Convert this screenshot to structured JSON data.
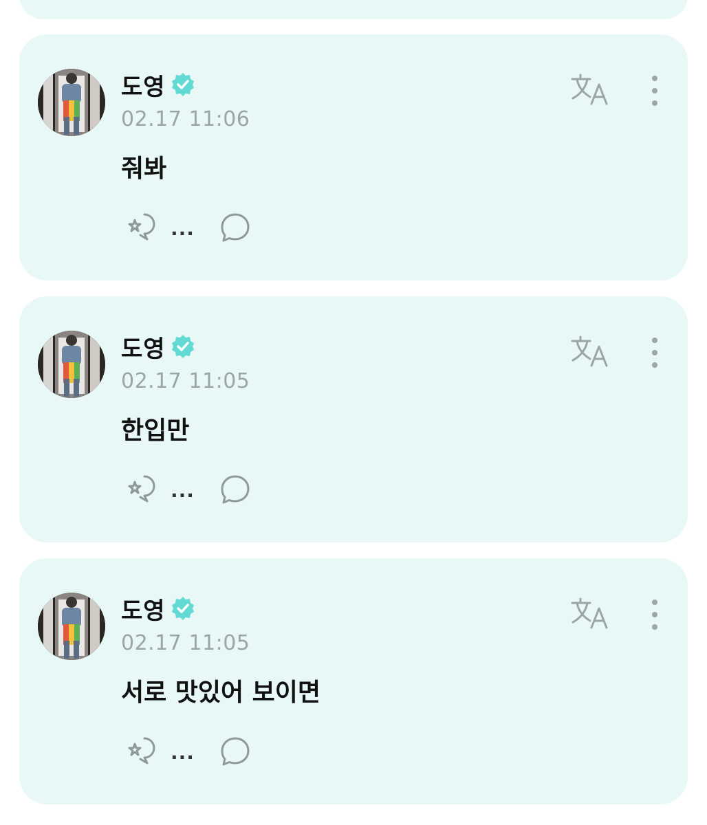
{
  "accent_color": "#63d9d3",
  "card_background": "#e8f8f6",
  "posts": [
    {
      "author": "도영",
      "time": "02.17 11:06",
      "message": "줘봐",
      "reaction_count": "...",
      "icons": {
        "verified": "verified-badge-icon",
        "translate": "translate-icon",
        "more": "more-vertical-icon",
        "reaction": "reaction-icon",
        "comment": "comment-bubble-icon"
      }
    },
    {
      "author": "도영",
      "time": "02.17 11:05",
      "message": "한입만",
      "reaction_count": "...",
      "icons": {
        "verified": "verified-badge-icon",
        "translate": "translate-icon",
        "more": "more-vertical-icon",
        "reaction": "reaction-icon",
        "comment": "comment-bubble-icon"
      }
    },
    {
      "author": "도영",
      "time": "02.17 11:05",
      "message": "서로 맛있어 보이면",
      "reaction_count": "...",
      "icons": {
        "verified": "verified-badge-icon",
        "translate": "translate-icon",
        "more": "more-vertical-icon",
        "reaction": "reaction-icon",
        "comment": "comment-bubble-icon"
      }
    }
  ]
}
